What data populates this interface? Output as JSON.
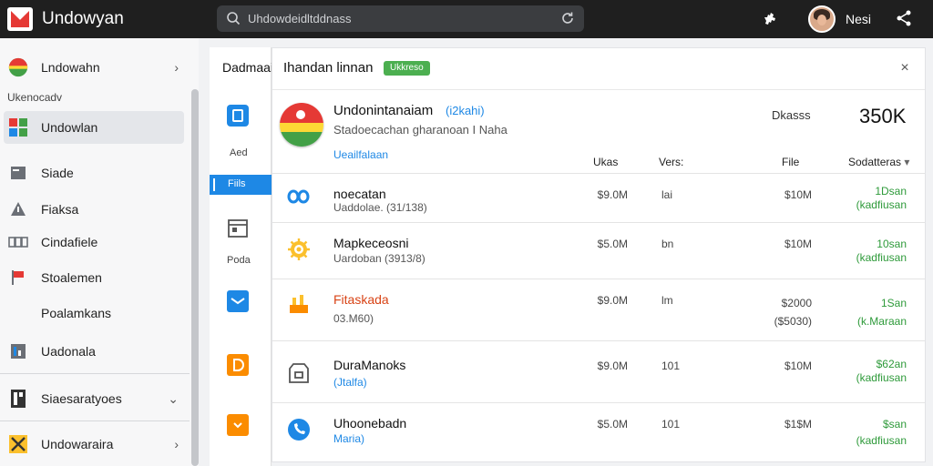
{
  "topbar": {
    "app_title": "Undowyan",
    "search_placeholder": "Uhdowdeidltddnass",
    "user_name": "Nesi"
  },
  "sidebar": {
    "section_label": "Ukenocadv",
    "items": [
      {
        "label": "Lndowahn",
        "icon": "flag-icon",
        "chevron": "›"
      },
      {
        "label": "Undowlan",
        "icon": "grid-icon",
        "active": true
      },
      {
        "label": "Siade",
        "icon": "folder-icon"
      },
      {
        "label": "Fiaksa",
        "icon": "warning-icon"
      },
      {
        "label": "Cindafiele",
        "icon": "cards-icon"
      },
      {
        "label": "Stoalemen",
        "icon": "flag-red-icon"
      },
      {
        "label": "Poalamkans",
        "icon": ""
      },
      {
        "label": "Uadonala",
        "icon": "chart-icon"
      },
      {
        "label": "Siaesaratyoes",
        "icon": "book-icon",
        "chevron": "⌄"
      },
      {
        "label": "Undowaraira",
        "icon": "star-icon",
        "chevron": "›"
      }
    ]
  },
  "midnav": {
    "heading": "Dadmaai",
    "items": [
      {
        "label": "Aed",
        "icon": "tablet-icon"
      },
      {
        "label": "Fiils",
        "icon": "",
        "active": true
      },
      {
        "label": "Poda",
        "icon": "window-icon"
      },
      {
        "label": "",
        "icon": "mail-icon"
      },
      {
        "label": "",
        "icon": "orange-d-icon"
      },
      {
        "label": "",
        "icon": "orange-chevron-icon"
      }
    ]
  },
  "panel": {
    "title": "Ihandan linnan",
    "badge": "Ukkreso",
    "close_label": "×",
    "app": {
      "name": "Undonintanaiam",
      "tag": "(i2kahi)",
      "subtitle": "Stadoecachan gharanoan I Naha",
      "link": "Ueailfalaan",
      "stat_label": "Dkasss",
      "stat_value": "350K"
    },
    "columns": {
      "ukas": "Ukas",
      "vers": "Vers:",
      "file": "File",
      "status": "Sodatteras"
    },
    "rows": [
      {
        "icon": "link-icon",
        "name": "noecatan",
        "sub": "Uaddolae. (31/138)",
        "size": "$9.0M",
        "ver": "lai",
        "file": "$10M",
        "status": "1Dsan\n(kadfiusan"
      },
      {
        "icon": "gear-icon",
        "name": "Mapkeceosni",
        "sub": "Uardoban (3913/8)",
        "size": "$5.0M",
        "ver": "bn",
        "file": "$10M",
        "status": "10san\n(kadfiusan"
      },
      {
        "icon": "fire-icon",
        "name": "Fitaskada",
        "sub": "03.M60)",
        "size": "$9.0M",
        "ver": "lm",
        "file": "$2000\n($5030)",
        "status": "1San\n(k.Maraan"
      },
      {
        "icon": "archive-icon",
        "name": "DuraManoks",
        "sub": "(Jtalfa)",
        "size": "$9.0M",
        "ver": "101",
        "file": "$10M",
        "status": "$62an\n(kadfiusan"
      },
      {
        "icon": "phone-icon",
        "name": "Uhoonebadn",
        "sub": "Maria)",
        "size": "$5.0M",
        "ver": "101",
        "file": "$1$M",
        "status": "$san\n(kadfiusan"
      }
    ]
  }
}
